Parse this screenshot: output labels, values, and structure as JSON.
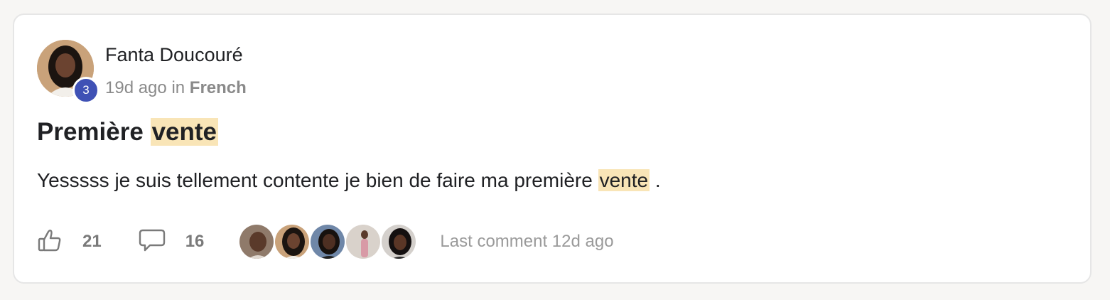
{
  "post": {
    "author": "Fanta Doucouré",
    "author_level": "3",
    "time_ago": "19d ago",
    "in_word": "in",
    "space": "French",
    "title_before": "Première ",
    "title_highlight": "vente",
    "body_before": "Yesssss je suis tellement contente je bien de faire ma première ",
    "body_highlight": "vente",
    "body_after": " ."
  },
  "footer": {
    "likes": "21",
    "comments": "16",
    "last_comment": "Last comment 12d ago",
    "like_icon": "thumbs-up-icon",
    "comment_icon": "speech-bubble-icon"
  },
  "colors": {
    "highlight": "#f9e5b7",
    "badge": "#3f51b5",
    "muted_text": "#8a8a8a"
  }
}
